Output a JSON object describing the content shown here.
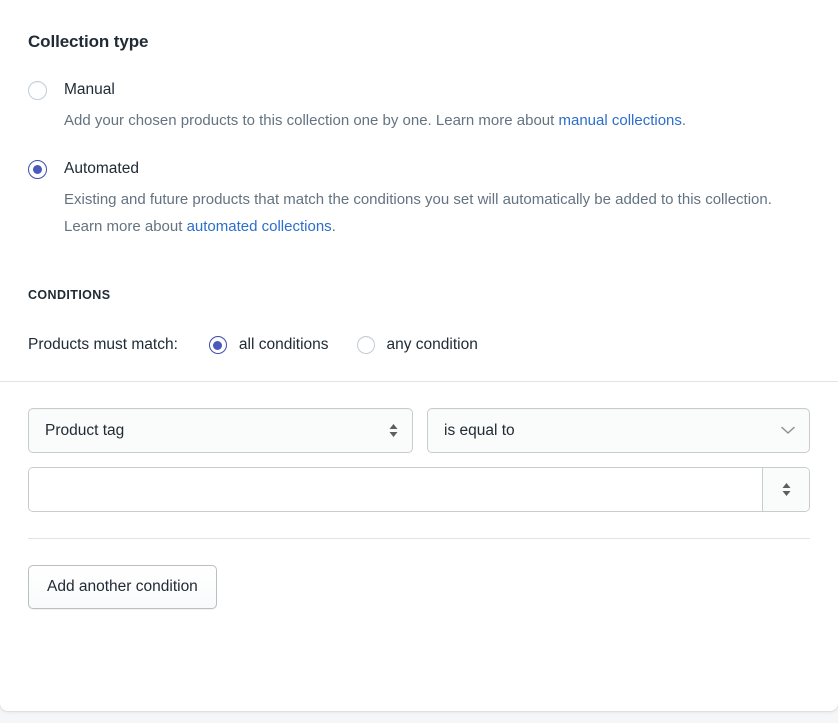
{
  "card": {
    "section_title": "Collection type"
  },
  "collection_type": {
    "options": [
      {
        "label": "Manual",
        "selected": false,
        "help_prefix": "Add your chosen products to this collection one by one. Learn more about ",
        "help_link": "manual collections",
        "help_suffix": "."
      },
      {
        "label": "Automated",
        "selected": true,
        "help_prefix": "Existing and future products that match the conditions you set will automatically be added to this collection. Learn more about ",
        "help_link": "automated collections",
        "help_suffix": "."
      }
    ]
  },
  "conditions": {
    "heading": "CONDITIONS",
    "match_label": "Products must match:",
    "match_options": [
      {
        "label": "all conditions",
        "selected": true
      },
      {
        "label": "any condition",
        "selected": false
      }
    ],
    "rows": [
      {
        "field_select": {
          "value": "Product tag",
          "icon": "chevron-up-down-icon"
        },
        "operator_select": {
          "value": "is equal to",
          "icon": "chevron-down-icon"
        },
        "value_input": {
          "value": "",
          "placeholder": "",
          "stepper_icon": "chevron-up-down-icon"
        }
      }
    ],
    "add_button_label": "Add another condition"
  },
  "colors": {
    "accent_radio": "#4959bd",
    "link": "#2c6ecb",
    "text": "#212b36",
    "subdued_text": "#637381",
    "border": "#c9cccf",
    "divider": "#e1e3e5",
    "field_bg": "#fafbfb",
    "page_bg": "#f4f6f8"
  }
}
